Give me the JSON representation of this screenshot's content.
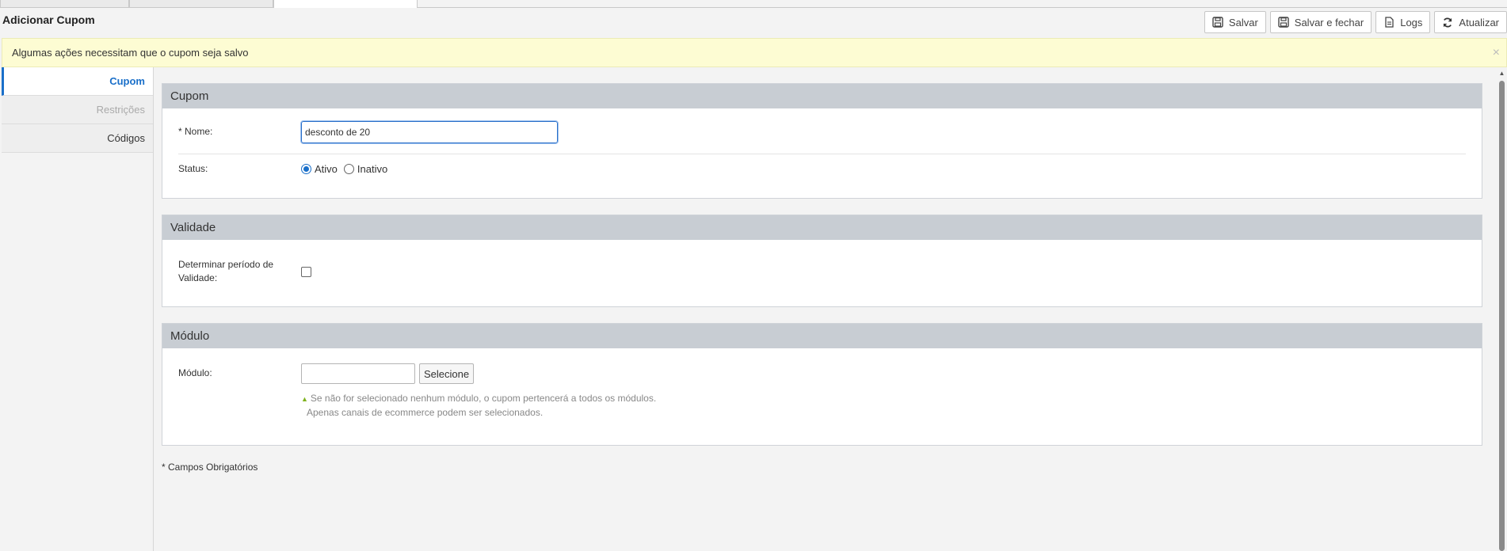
{
  "page": {
    "title": "Adicionar Cupom"
  },
  "toolbar": {
    "save_label": "Salvar",
    "save_close_label": "Salvar e fechar",
    "logs_label": "Logs",
    "refresh_label": "Atualizar"
  },
  "alert": {
    "message": "Algumas ações necessitam que o cupom seja salvo",
    "close_glyph": "×"
  },
  "sidebar": {
    "items": [
      {
        "label": "Cupom",
        "state": "active"
      },
      {
        "label": "Restrições",
        "state": "disabled"
      },
      {
        "label": "Códigos",
        "state": "normal"
      }
    ]
  },
  "cupom_panel": {
    "title": "Cupom",
    "name_label": "* Nome:",
    "name_value": "desconto de 20",
    "status_label": "Status:",
    "status_options": [
      "Ativo",
      "Inativo"
    ],
    "status_selected": "Ativo"
  },
  "validade_panel": {
    "title": "Validade",
    "period_label_line1": "Determinar período de",
    "period_label_line2": "Validade:",
    "period_checked": false
  },
  "modulo_panel": {
    "title": "Módulo",
    "modulo_label": "Módulo:",
    "modulo_value": "",
    "select_button": "Selecione",
    "hint_line1": "Se não for selecionado nenhum módulo, o cupom pertencerá a todos os módulos.",
    "hint_line2": "Apenas canais de ecommerce podem ser selecionados."
  },
  "footer": {
    "required_note": "* Campos Obrigatórios"
  },
  "colors": {
    "accent": "#1a6fc9",
    "alert_bg": "#fdfcd3",
    "panel_header": "#c8cdd3",
    "hint_marker": "#7fb21e"
  }
}
